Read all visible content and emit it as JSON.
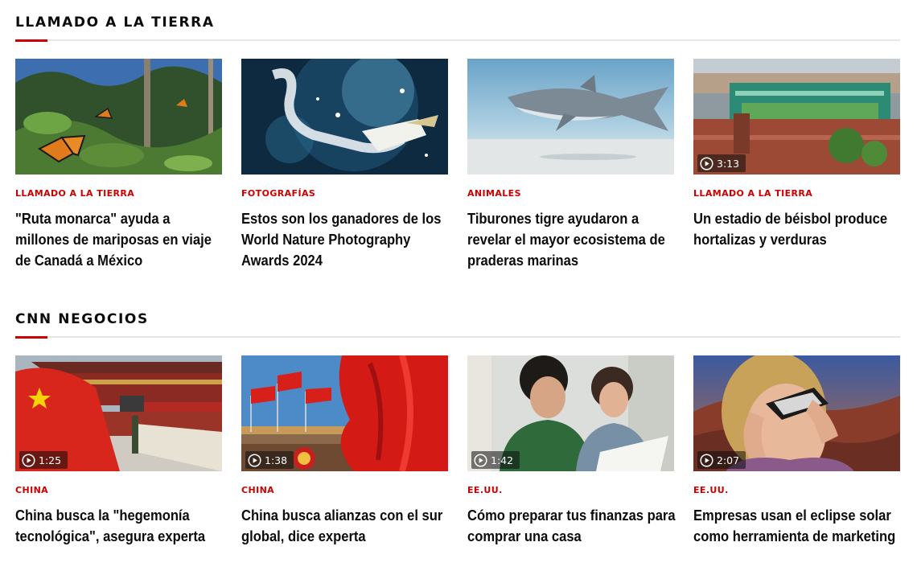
{
  "sections": [
    {
      "title": "LLAMADO A LA TIERRA",
      "cards": [
        {
          "kicker": "LLAMADO A LA TIERRA",
          "headline": "\"Ruta monarca\" ayuda a millones de mariposas en viaje de Canadá a México",
          "image": "monarch-butterflies-forest"
        },
        {
          "kicker": "FOTOGRAFÍAS",
          "headline": "Estos son los ganadores de los World Nature Photography Awards 2024",
          "image": "gannet-diving-underwater"
        },
        {
          "kicker": "ANIMALES",
          "headline": "Tiburones tigre ayudaron a revelar el mayor ecosistema de praderas marinas",
          "image": "tiger-shark-seabed"
        },
        {
          "kicker": "LLAMADO A LA TIERRA",
          "headline": "Un estadio de béisbol produce hortalizas y verduras",
          "image": "baseball-stadium-rooftop",
          "duration": "3:13"
        }
      ]
    },
    {
      "title": "CNN NEGOCIOS",
      "cards": [
        {
          "kicker": "CHINA",
          "headline": "China busca la \"hegemonía tecnológica\", asegura experta",
          "image": "tiananmen-gate-flag-guard",
          "duration": "1:25"
        },
        {
          "kicker": "CHINA",
          "headline": "China busca alianzas con el sur global, dice experta",
          "image": "red-flags-great-hall",
          "duration": "1:38"
        },
        {
          "kicker": "EE.UU.",
          "headline": "Cómo preparar tus finanzas para comprar una casa",
          "image": "couple-reviewing-papers",
          "duration": "1:42"
        },
        {
          "kicker": "EE.UU.",
          "headline": "Empresas usan el eclipse solar como herramienta de marketing",
          "image": "woman-eclipse-glasses",
          "duration": "2:07"
        }
      ]
    }
  ],
  "icons": {
    "play": "play-circle-icon"
  },
  "colors": {
    "accent": "#cc0000",
    "text": "#0c0c0c",
    "rule": "#e6e6e6"
  }
}
